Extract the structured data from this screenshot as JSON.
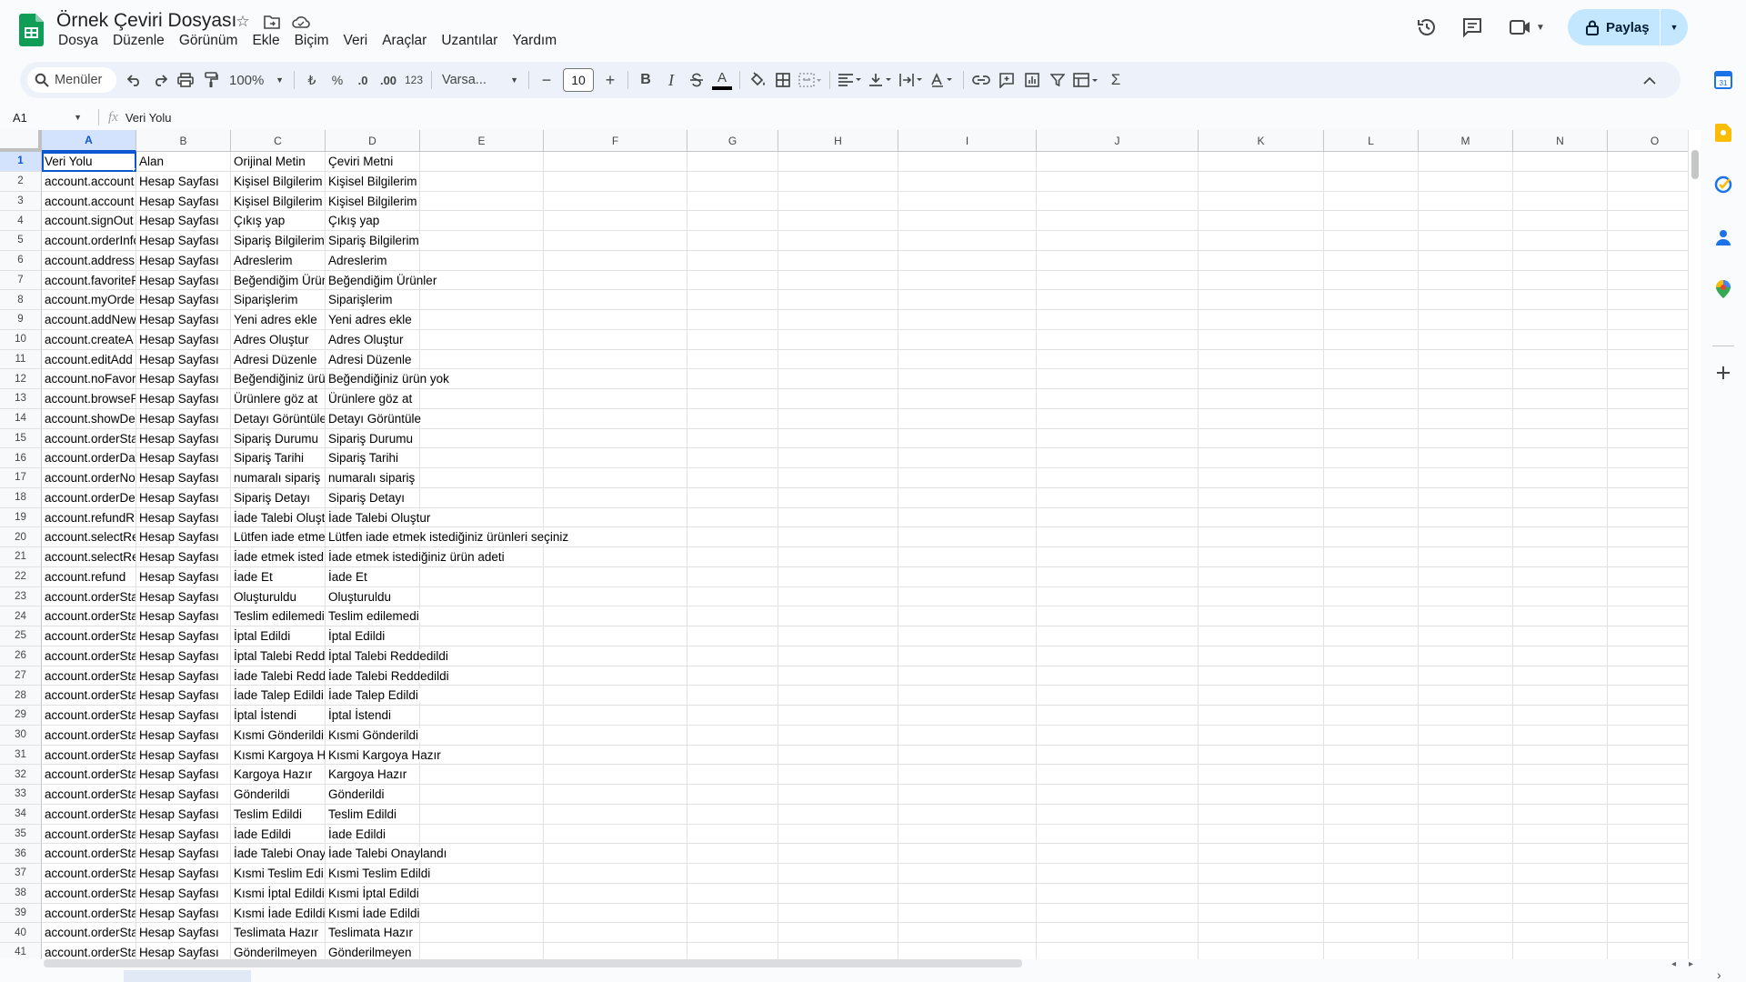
{
  "doc": {
    "title": "Örnek Çeviri Dosyası"
  },
  "menu": [
    "Dosya",
    "Düzenle",
    "Görünüm",
    "Ekle",
    "Biçim",
    "Veri",
    "Araçlar",
    "Uzantılar",
    "Yardım"
  ],
  "share": {
    "label": "Paylaş"
  },
  "toolbar": {
    "search_label": "Menüler",
    "zoom": "100%",
    "currency": "₺",
    "percent": "%",
    "decrease_decimal": ".0",
    "increase_decimal": ".00",
    "number_format": "123",
    "font": "Varsa...",
    "font_size": "10",
    "bold": "B",
    "italic": "I",
    "text_color_letter": "A"
  },
  "formula_bar": {
    "cell_ref": "A1",
    "fx": "fx",
    "content": "Veri Yolu"
  },
  "grid": {
    "columns": [
      "A",
      "B",
      "C",
      "D",
      "E",
      "F",
      "G",
      "H",
      "I",
      "J",
      "K",
      "L",
      "M",
      "N",
      "O"
    ],
    "rows": [
      [
        "1",
        "Veri Yolu",
        "Alan",
        "Orijinal Metin",
        "Çeviri Metni"
      ],
      [
        "2",
        "account.account",
        "Hesap Sayfası",
        "Kişisel Bilgilerim",
        "Kişisel Bilgilerim"
      ],
      [
        "3",
        "account.account",
        "Hesap Sayfası",
        "Kişisel Bilgilerim",
        "Kişisel Bilgilerim"
      ],
      [
        "4",
        "account.signOut",
        "Hesap Sayfası",
        "Çıkış yap",
        "Çıkış yap"
      ],
      [
        "5",
        "account.orderInfo",
        "Hesap Sayfası",
        "Sipariş Bilgilerim",
        "Sipariş Bilgilerim"
      ],
      [
        "6",
        "account.address",
        "Hesap Sayfası",
        "Adreslerim",
        "Adreslerim"
      ],
      [
        "7",
        "account.favoriteP",
        "Hesap Sayfası",
        "Beğendiğim Ürün",
        "Beğendiğim Ürünler"
      ],
      [
        "8",
        "account.myOrde",
        "Hesap Sayfası",
        "Siparişlerim",
        "Siparişlerim"
      ],
      [
        "9",
        "account.addNew",
        "Hesap Sayfası",
        "Yeni adres ekle",
        "Yeni adres ekle"
      ],
      [
        "10",
        "account.createA",
        "Hesap Sayfası",
        "Adres Oluştur",
        "Adres Oluştur"
      ],
      [
        "11",
        "account.editAdd",
        "Hesap Sayfası",
        "Adresi Düzenle",
        "Adresi Düzenle"
      ],
      [
        "12",
        "account.noFavor",
        "Hesap Sayfası",
        "Beğendiğiniz ürü",
        "Beğendiğiniz ürün yok"
      ],
      [
        "13",
        "account.browseP",
        "Hesap Sayfası",
        "Ürünlere göz at",
        "Ürünlere göz at"
      ],
      [
        "14",
        "account.showDe",
        "Hesap Sayfası",
        "Detayı Görüntüle",
        "Detayı Görüntüle"
      ],
      [
        "15",
        "account.orderSta",
        "Hesap Sayfası",
        "Sipariş Durumu",
        "Sipariş Durumu"
      ],
      [
        "16",
        "account.orderDa",
        "Hesap Sayfası",
        "Sipariş Tarihi",
        "Sipariş Tarihi"
      ],
      [
        "17",
        "account.orderNo",
        "Hesap Sayfası",
        "numaralı sipariş",
        "numaralı sipariş"
      ],
      [
        "18",
        "account.orderDe",
        "Hesap Sayfası",
        "Sipariş Detayı",
        "Sipariş Detayı"
      ],
      [
        "19",
        "account.refundR",
        "Hesap Sayfası",
        "İade Talebi Oluşt",
        "İade Talebi Oluştur"
      ],
      [
        "20",
        "account.selectRe",
        "Hesap Sayfası",
        "Lütfen iade etme",
        "Lütfen iade etmek istediğiniz ürünleri seçiniz"
      ],
      [
        "21",
        "account.selectRe",
        "Hesap Sayfası",
        "İade etmek isted",
        "İade etmek istediğiniz ürün adeti"
      ],
      [
        "22",
        "account.refund",
        "Hesap Sayfası",
        "İade Et",
        "İade Et"
      ],
      [
        "23",
        "account.orderSta",
        "Hesap Sayfası",
        "Oluşturuldu",
        "Oluşturuldu"
      ],
      [
        "24",
        "account.orderSta",
        "Hesap Sayfası",
        "Teslim edilemedi",
        "Teslim edilemedi"
      ],
      [
        "25",
        "account.orderSta",
        "Hesap Sayfası",
        "İptal Edildi",
        "İptal Edildi"
      ],
      [
        "26",
        "account.orderSta",
        "Hesap Sayfası",
        "İptal Talebi Redd",
        "İptal Talebi Reddedildi"
      ],
      [
        "27",
        "account.orderSta",
        "Hesap Sayfası",
        "İade Talebi Redd",
        "İade Talebi Reddedildi"
      ],
      [
        "28",
        "account.orderSta",
        "Hesap Sayfası",
        "İade Talep Edildi",
        "İade Talep Edildi"
      ],
      [
        "29",
        "account.orderSta",
        "Hesap Sayfası",
        "İptal İstendi",
        "İptal İstendi"
      ],
      [
        "30",
        "account.orderSta",
        "Hesap Sayfası",
        "Kısmi Gönderildi",
        "Kısmi Gönderildi"
      ],
      [
        "31",
        "account.orderSta",
        "Hesap Sayfası",
        "Kısmi Kargoya H",
        "Kısmi Kargoya Hazır"
      ],
      [
        "32",
        "account.orderSta",
        "Hesap Sayfası",
        "Kargoya Hazır",
        "Kargoya Hazır"
      ],
      [
        "33",
        "account.orderSta",
        "Hesap Sayfası",
        "Gönderildi",
        "Gönderildi"
      ],
      [
        "34",
        "account.orderSta",
        "Hesap Sayfası",
        "Teslim Edildi",
        "Teslim Edildi"
      ],
      [
        "35",
        "account.orderSta",
        "Hesap Sayfası",
        "İade Edildi",
        "İade Edildi"
      ],
      [
        "36",
        "account.orderSta",
        "Hesap Sayfası",
        "İade Talebi Onay",
        "İade Talebi Onaylandı"
      ],
      [
        "37",
        "account.orderSta",
        "Hesap Sayfası",
        "Kısmi Teslim Edi",
        "Kısmi Teslim Edildi"
      ],
      [
        "38",
        "account.orderSta",
        "Hesap Sayfası",
        "Kısmi İptal Edildi",
        "Kısmi İptal Edildi"
      ],
      [
        "39",
        "account.orderSta",
        "Hesap Sayfası",
        "Kısmi İade Edildi",
        "Kısmi İade Edildi"
      ],
      [
        "40",
        "account.orderSta",
        "Hesap Sayfası",
        "Teslimata Hazır",
        "Teslimata Hazır"
      ],
      [
        "41",
        "account.orderSta",
        "Hesap Sayfası",
        "Gönderilmeyen",
        "Gönderilmeyen"
      ]
    ]
  },
  "side_panel": {
    "calendar_day": "31"
  }
}
